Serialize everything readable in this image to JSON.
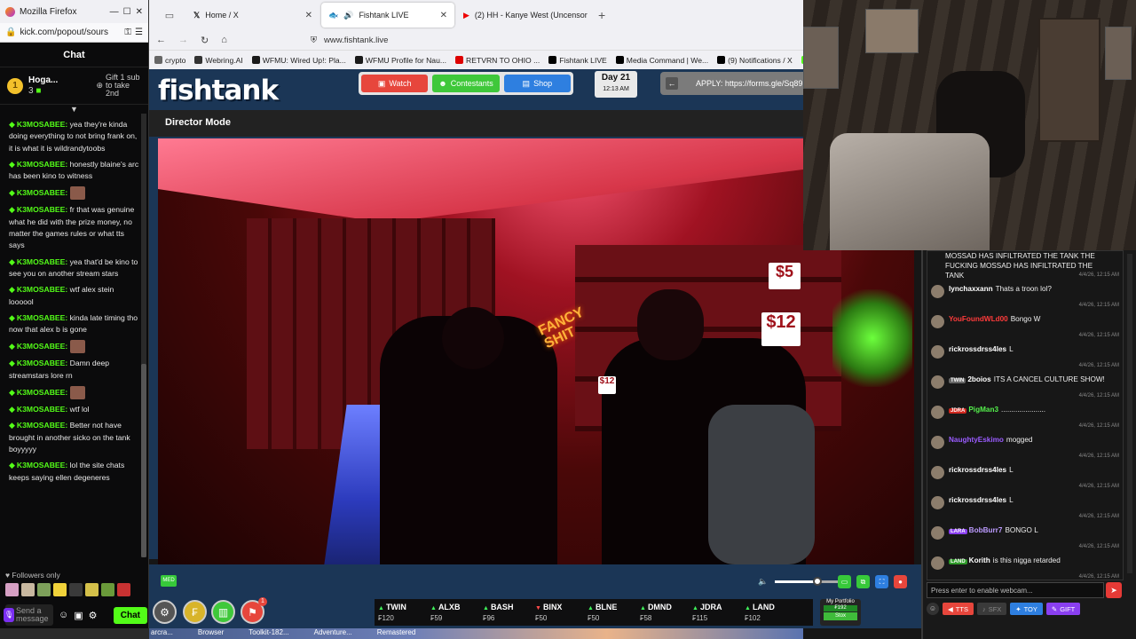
{
  "kick_window": {
    "title": "Mozilla Firefox",
    "url": "kick.com/popout/sours",
    "chat_header": "Chat",
    "pinned": {
      "name": "Hoga...",
      "count": "3",
      "gift": "Gift 1 sub to take 2nd",
      "rank": "1"
    },
    "messages": [
      {
        "user": "K3MOSABEE:",
        "text": "yea they're kinda doing everything to not bring frank on, it is what it is wildrandytoobs"
      },
      {
        "user": "K3MOSABEE:",
        "text": "honestly blaine's arc has been kino to witness"
      },
      {
        "user": "K3MOSABEE:",
        "text": "",
        "emote": true
      },
      {
        "user": "K3MOSABEE:",
        "text": "fr that was genuine what he did with the prize money, no matter the games rules or what tts says"
      },
      {
        "user": "K3MOSABEE:",
        "text": "yea that'd be kino to see you on another stream stars"
      },
      {
        "user": "K3MOSABEE:",
        "text": "wtf alex stein loooool"
      },
      {
        "user": "K3MOSABEE:",
        "text": "kinda late timing tho now that alex b is gone"
      },
      {
        "user": "K3MOSABEE:",
        "text": "",
        "emote": true
      },
      {
        "user": "K3MOSABEE:",
        "text": "Damn deep streamstars lore rn"
      },
      {
        "user": "K3MOSABEE:",
        "text": "",
        "emote": true
      },
      {
        "user": "K3MOSABEE:",
        "text": "wtf lol"
      },
      {
        "user": "K3MOSABEE:",
        "text": "Better not have brought in another sicko on the tank boyyyyy"
      },
      {
        "user": "K3MOSABEE:",
        "text": "lol the site chats keeps saying ellen degeneres"
      }
    ],
    "followers_only": "Followers only",
    "send_placeholder": "Send a message",
    "chat_button": "Chat"
  },
  "browser": {
    "tabs": [
      {
        "label": "Home / X",
        "active": false
      },
      {
        "label": "Fishtank LIVE",
        "active": true
      },
      {
        "label": "(2) HH - Kanye West (Uncensor",
        "active": false
      }
    ],
    "address": "www.fishtank.live",
    "bookmarks": [
      "crypto",
      "Webring.AI",
      "WFMU: Wired Up!: Pla...",
      "WFMU Profile for Nau...",
      "RETVRN TO OHIO ...",
      "Fishtank LIVE",
      "Media Command | We...",
      "(9) Notifications / X",
      "Kick"
    ]
  },
  "fishtank": {
    "logo": "fishtank",
    "nav": {
      "watch": "Watch",
      "contestants": "Contestants",
      "shop": "Shop"
    },
    "day": {
      "label": "Day 21",
      "time": "12:13 AM"
    },
    "apply": "APPLY: https://forms.gle/Sq89",
    "director_mode": "Director Mode",
    "scene_signs": {
      "neon": "FANCY SHIT",
      "price1": "$5",
      "price2": "$12",
      "price3": "$12"
    },
    "quality_badge": "MED",
    "volume": 0.6,
    "ticker": [
      {
        "name": "TWIN",
        "price": "₣120",
        "up": true
      },
      {
        "name": "ALXB",
        "price": "₣59",
        "up": true
      },
      {
        "name": "BASH",
        "price": "₣96",
        "up": true
      },
      {
        "name": "BINX",
        "price": "₣50",
        "up": false
      },
      {
        "name": "BLNE",
        "price": "₣50",
        "up": true
      },
      {
        "name": "DMND",
        "price": "₣58",
        "up": true
      },
      {
        "name": "JDRA",
        "price": "₣115",
        "up": true
      },
      {
        "name": "LAND",
        "price": "₣102",
        "up": true
      }
    ],
    "portfolio": {
      "label": "My Portfolio",
      "value": "₣192",
      "action": "Stox"
    },
    "notif_count": "1"
  },
  "right_chat": {
    "top_lines": [
      "MOSSAD HAS INFILTRATED THE TANK THE",
      "FUCKING MOSSAD HAS INFILTRATED THE TANK"
    ],
    "messages": [
      {
        "user": "lynchaxxann",
        "text": "Thats a troon lol?",
        "color": "#ffffff",
        "tag": ""
      },
      {
        "user": "YouFoundWLd00",
        "text": "Bongo W",
        "color": "#ff3b3b",
        "tag": ""
      },
      {
        "user": "rickrossdrss4les",
        "text": "L",
        "color": "#ffffff",
        "tag": ""
      },
      {
        "user": "2boios",
        "text": "ITS A CANCEL CULTURE SHOW!",
        "color": "#ffffff",
        "tag": "TWIN"
      },
      {
        "user": "PigMan3",
        "text": "......................",
        "color": "#54f04c",
        "tag": "JDRA"
      },
      {
        "user": "NaughtyEskimo",
        "text": "mogged",
        "color": "#9a5cff",
        "tag": ""
      },
      {
        "user": "rickrossdrss4les",
        "text": "L",
        "color": "#ffffff",
        "tag": ""
      },
      {
        "user": "rickrossdrss4les",
        "text": "L",
        "color": "#ffffff",
        "tag": ""
      },
      {
        "user": "BobBurr7",
        "text": "BONGO L",
        "color": "#bc9bff",
        "tag": "LARA"
      },
      {
        "user": "Korith",
        "text": "is this nigga retarded",
        "color": "#ffffff",
        "tag": "LAND"
      }
    ],
    "timestamp": "4/4/26, 12:15 AM",
    "input_placeholder": "Press enter to enable webcam...",
    "actions": {
      "tts": "TTS",
      "sfx": "SFX",
      "toy": "TOY",
      "gift": "GIFT"
    }
  },
  "taskbar": [
    "arcra...",
    "Browser",
    "Toolkit-182...",
    "Adventure...",
    "Remastered"
  ],
  "colors": {
    "kick_green": "#53fc18",
    "fishtank_blue": "#1b3656",
    "watch": "#e7463c",
    "contestants": "#3fc83a",
    "shop": "#2e7fe0"
  }
}
